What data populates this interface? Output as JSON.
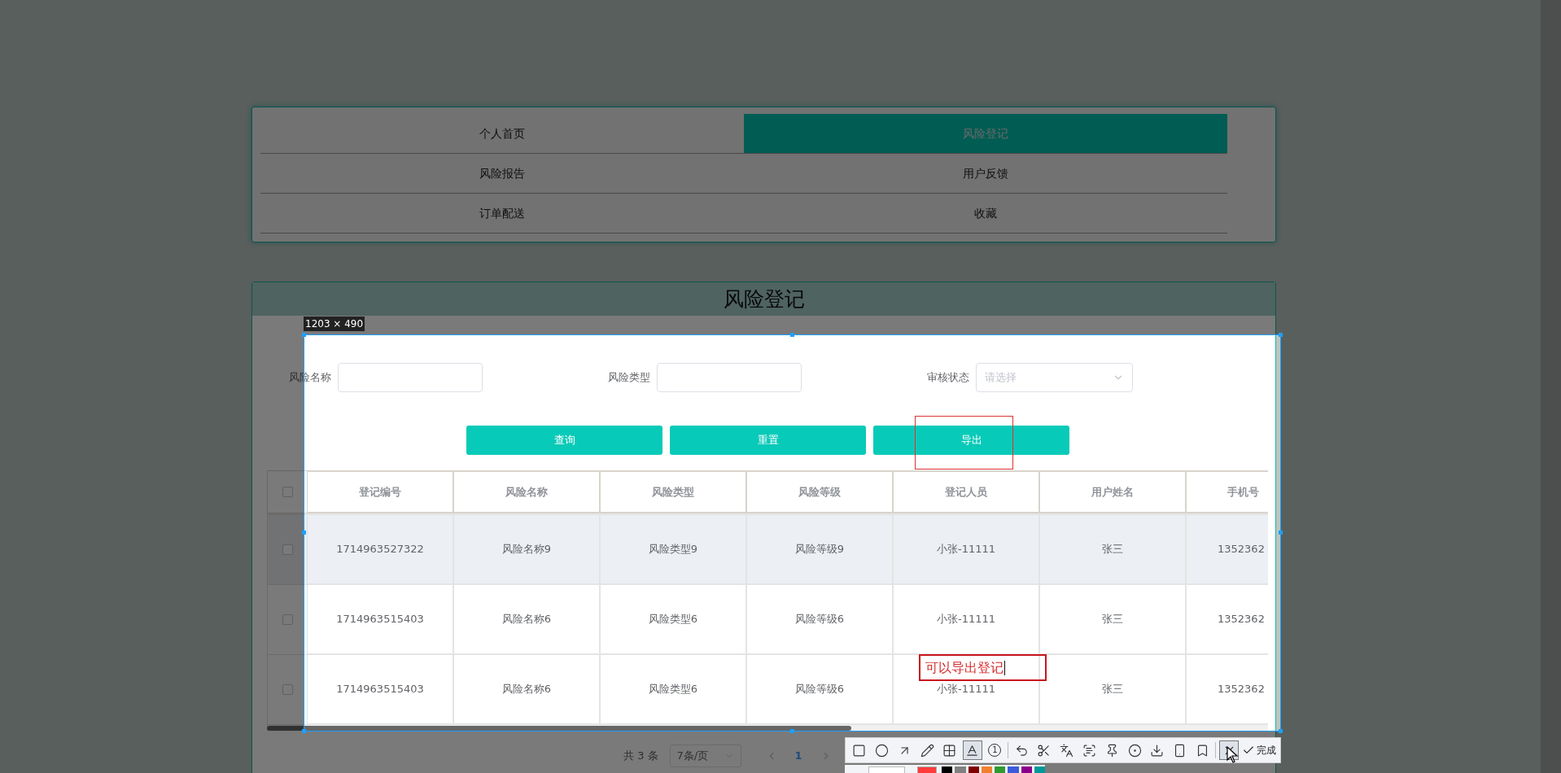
{
  "nav": [
    {
      "label": "个人首页",
      "selected": false
    },
    {
      "label": "风险登记",
      "selected": true
    },
    {
      "label": "风险报告",
      "selected": false
    },
    {
      "label": "用户反馈",
      "selected": false
    },
    {
      "label": "订单配送",
      "selected": false
    },
    {
      "label": "收藏",
      "selected": false
    }
  ],
  "panel": {
    "title": "风险登记"
  },
  "filters": [
    {
      "label": "风险名称",
      "kind": "input"
    },
    {
      "label": "风险类型",
      "kind": "input"
    },
    {
      "label": "审核状态",
      "kind": "select",
      "placeholder": "请选择"
    }
  ],
  "buttons": [
    "查询",
    "重置",
    "导出"
  ],
  "table": {
    "select_all": {
      "checked": false
    },
    "columns": [
      "登记编号",
      "风险名称",
      "风险类型",
      "风险等级",
      "登记人员",
      "用户姓名",
      "手机号"
    ],
    "rows": [
      {
        "checked": false,
        "highlighted": true,
        "cells": [
          "1714963527322",
          "风险名称9",
          "风险类型9",
          "风险等级9",
          "小张-11111",
          "张三",
          "1352362"
        ]
      },
      {
        "checked": false,
        "highlighted": false,
        "cells": [
          "1714963515403",
          "风险名称6",
          "风险类型6",
          "风险等级6",
          "小张-11111",
          "张三",
          "1352362"
        ]
      },
      {
        "checked": false,
        "highlighted": false,
        "cells": [
          "1714963515403",
          "风险名称6",
          "风险类型6",
          "风险等级6",
          "小张-11111",
          "张三",
          "1352362"
        ]
      }
    ]
  },
  "pagination": {
    "total": "共 3 条",
    "page_size": "7条/页",
    "pages": [
      {
        "label": "1",
        "selected": true
      }
    ]
  },
  "capture": {
    "size_label": "1203 × 490",
    "annotations": [
      {
        "kind": "rect"
      },
      {
        "kind": "text",
        "text": "可以导出登记"
      }
    ],
    "tools": [
      {
        "kind": "rect",
        "selected": false
      },
      {
        "kind": "circle",
        "selected": false
      },
      {
        "kind": "arrow",
        "selected": false
      },
      {
        "kind": "pencil",
        "selected": false
      },
      {
        "kind": "mosaic",
        "selected": false
      },
      {
        "kind": "text",
        "selected": true
      },
      {
        "kind": "number",
        "label": "1",
        "selected": false
      },
      {
        "kind": "undo",
        "selected": false
      },
      {
        "kind": "cut",
        "selected": false
      },
      {
        "kind": "translate",
        "selected": false
      },
      {
        "kind": "ocr",
        "selected": false
      },
      {
        "kind": "pin",
        "selected": false
      },
      {
        "kind": "record",
        "selected": false
      },
      {
        "kind": "download",
        "selected": false
      },
      {
        "kind": "phone",
        "selected": false
      },
      {
        "kind": "bookmark",
        "selected": false
      },
      {
        "kind": "close",
        "selected": true
      }
    ],
    "done": "完成",
    "palette": [
      {
        "color": "#ff3b3b",
        "selected": true
      },
      {
        "color": "#000000",
        "selected": false
      },
      {
        "color": "#808080",
        "selected": false
      },
      {
        "color": "#800000",
        "selected": false
      },
      {
        "color": "#f08030",
        "selected": false
      },
      {
        "color": "#2e9b2e",
        "selected": false
      },
      {
        "color": "#3b5bdb",
        "selected": false
      },
      {
        "color": "#8b008b",
        "selected": false
      },
      {
        "color": "#009999",
        "selected": false
      }
    ]
  }
}
